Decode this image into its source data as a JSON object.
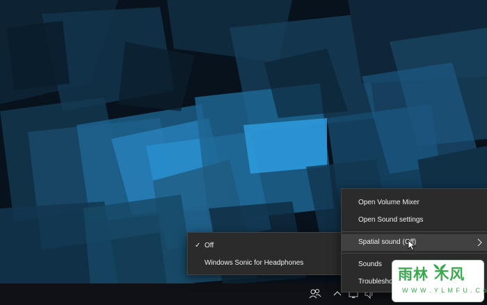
{
  "colors": {
    "wallpaper_base": "#08121c",
    "wallpaper_accent": "#1f8fcf",
    "menu_bg": "#2b2b2b",
    "menu_hover": "#414141",
    "menu_text": "#f1f1f1",
    "watermark_green": "#38a94c"
  },
  "context_menu": {
    "items": [
      {
        "label": "Open Volume Mixer"
      },
      {
        "label": "Open Sound settings"
      },
      {
        "label": "Spatial sound (Off)",
        "has_submenu": true,
        "highlighted": true
      },
      {
        "label": "Sounds"
      },
      {
        "label": "Troubleshoot sound problems"
      }
    ]
  },
  "submenu": {
    "items": [
      {
        "label": "Off",
        "checked": true
      },
      {
        "label": "Windows Sonic for Headphones",
        "checked": false
      }
    ],
    "check_glyph": "✓"
  },
  "taskbar": {
    "icons": [
      "people-icon",
      "chevron-up-icon",
      "network-icon",
      "volume-icon"
    ]
  },
  "watermark": {
    "main_text": "雨林 木风",
    "sub_text": "W W W . Y L M F U . C o M"
  }
}
